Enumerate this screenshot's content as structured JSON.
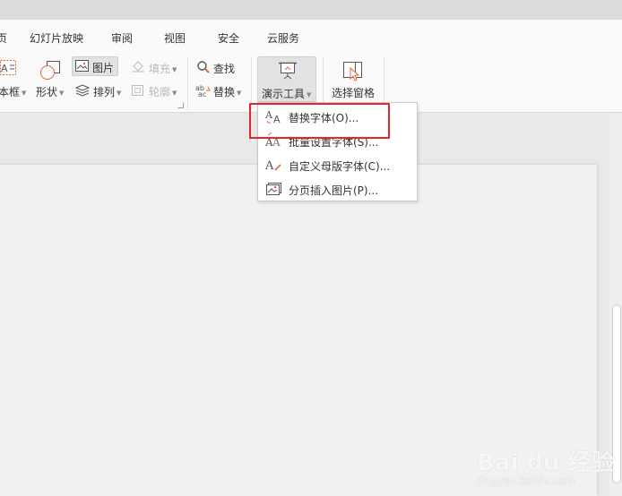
{
  "menu": {
    "partial_tab": "页",
    "tabs": [
      "幻灯片放映",
      "审阅",
      "视图",
      "安全",
      "云服务"
    ]
  },
  "ribbon": {
    "textbox_label": "本框",
    "shape_label": "形状",
    "image_label": "图片",
    "arrange_label": "排列",
    "fill_label": "填充",
    "outline_label": "轮廓",
    "find_label": "查找",
    "replace_label": "替换",
    "present_tools_label": "演示工具",
    "selection_pane_label": "选择窗格"
  },
  "dropdown": {
    "items": [
      {
        "label": "替换字体(O)...",
        "icon": "replace-font-icon"
      },
      {
        "label": "批量设置字体(S)...",
        "icon": "batch-font-icon"
      },
      {
        "label": "自定义母版字体(C)...",
        "icon": "custom-master-font-icon"
      },
      {
        "label": "分页插入图片(P)...",
        "icon": "insert-picture-pages-icon"
      }
    ]
  },
  "watermark": {
    "logo": "Bai du 经验",
    "url": "jingyan.baidu.com"
  },
  "colors": {
    "highlight": "#e4262b",
    "accent_icon": "#e0683a",
    "ribbon_bg": "#fafafa"
  }
}
